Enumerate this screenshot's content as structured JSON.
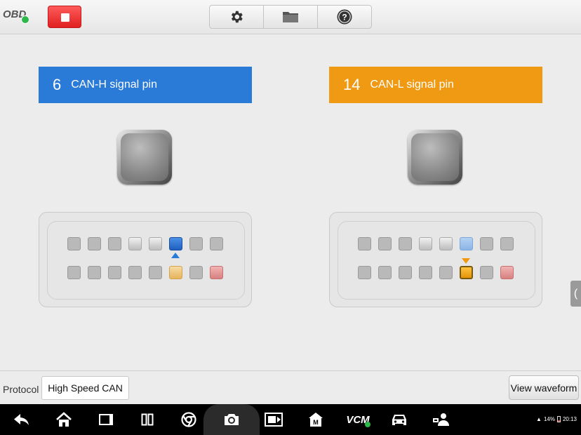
{
  "topbar": {
    "app_label": "OBD",
    "stop_icon": "stop-square-icon",
    "tools": [
      "gear-icon",
      "folder-icon",
      "help-icon"
    ]
  },
  "left_panel": {
    "pin_number": "6",
    "pin_label": "CAN-H signal pin",
    "color": "#2a7ad8"
  },
  "right_panel": {
    "pin_number": "14",
    "pin_label": "CAN-L signal pin",
    "color": "#f09a14"
  },
  "bottom": {
    "protocol_label": "Protocol",
    "protocol_value": "High Speed CAN",
    "view_waveform": "View waveform"
  },
  "side_tab": "(",
  "navbar": {
    "vcm_label": "VCM",
    "icons": [
      "back-icon",
      "home-icon",
      "recent-apps-icon",
      "split-screen-icon",
      "browser-icon",
      "camera-icon",
      "screen-capture-icon",
      "maxifix-icon",
      "vcm-icon",
      "vehicle-icon",
      "user-support-icon"
    ]
  },
  "status": {
    "battery": "14%",
    "time": "20:13"
  }
}
